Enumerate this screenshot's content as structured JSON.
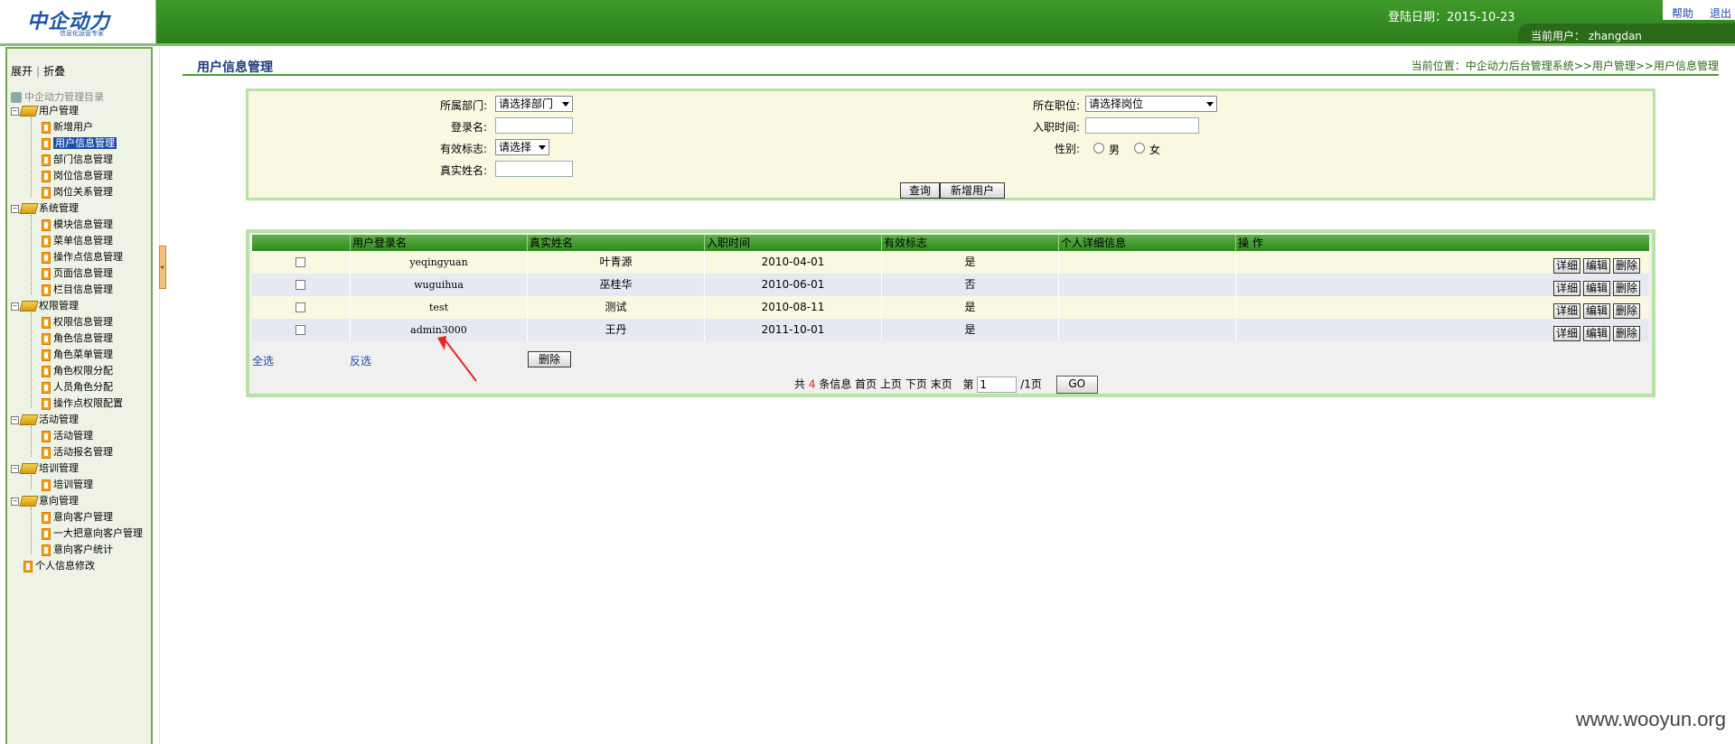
{
  "header": {
    "logo_text": "中企动力",
    "logo_sub": "信息化运营专家",
    "login_date_label": "登陆日期：2015-10-23",
    "help": "帮助",
    "logout": "退出",
    "current_user_label": "当前用户：",
    "current_user": "zhangdan"
  },
  "sidebar": {
    "expand": "展开",
    "collapse": "折叠",
    "root": "中企动力管理目录",
    "groups": [
      {
        "label": "用户管理",
        "items": [
          "新增用户",
          "用户信息管理",
          "部门信息管理",
          "岗位信息管理",
          "岗位关系管理"
        ]
      },
      {
        "label": "系统管理",
        "items": [
          "模块信息管理",
          "菜单信息管理",
          "操作点信息管理",
          "页面信息管理",
          "栏目信息管理"
        ]
      },
      {
        "label": "权限管理",
        "items": [
          "权限信息管理",
          "角色信息管理",
          "角色菜单管理",
          "角色权限分配",
          "人员角色分配",
          "操作点权限配置"
        ]
      },
      {
        "label": "活动管理",
        "items": [
          "活动管理",
          "活动报名管理"
        ]
      },
      {
        "label": "培训管理",
        "items": [
          "培训管理"
        ]
      },
      {
        "label": "意向管理",
        "items": [
          "意向客户管理",
          "一大把意向客户管理",
          "意向客户统计"
        ]
      }
    ],
    "personal": "个人信息修改",
    "selected": "用户信息管理"
  },
  "page": {
    "title": "用户信息管理",
    "breadcrumb": "当前位置：中企动力后台管理系统>>用户管理>>用户信息管理"
  },
  "search": {
    "dept_label": "所属部门:",
    "dept_value": "请选择部门",
    "position_label": "所在职位:",
    "position_value": "请选择岗位",
    "login_label": "登录名:",
    "hire_label": "入职时间:",
    "valid_label": "有效标志:",
    "valid_value": "请选择",
    "gender_label": "性别:",
    "male": "男",
    "female": "女",
    "realname_label": "真实姓名:",
    "query_btn": "查询",
    "add_btn": "新增用户"
  },
  "table": {
    "headers": [
      "",
      "用户登录名",
      "真实姓名",
      "入职时间",
      "有效标志",
      "个人详细信息",
      "操 作"
    ],
    "rows": [
      {
        "login": "yeqingyuan",
        "name": "叶青源",
        "date": "2010-04-01",
        "valid": "是"
      },
      {
        "login": "wuguihua",
        "name": "巫桂华",
        "date": "2010-06-01",
        "valid": "否"
      },
      {
        "login": "test",
        "name": "测试",
        "date": "2010-08-11",
        "valid": "是"
      },
      {
        "login": "admin3000",
        "name": "王丹",
        "date": "2011-10-01",
        "valid": "是"
      }
    ],
    "ops": [
      "详细",
      "编辑",
      "删除"
    ],
    "select_all": "全选",
    "invert": "反选",
    "delete_btn": "删除"
  },
  "pager": {
    "total_prefix": "共",
    "total": "4",
    "total_suffix": "条信息",
    "first": "首页",
    "prev": "上页",
    "next": "下页",
    "last": "末页",
    "page_prefix": "第",
    "page_value": "1",
    "page_suffix": "/1页",
    "go": "GO"
  },
  "watermark": "www.wooyun.org",
  "colors": {
    "brand_green": "#2c7d1c",
    "link_blue": "#1b4aa8",
    "annotation_red": "#e8231a"
  }
}
